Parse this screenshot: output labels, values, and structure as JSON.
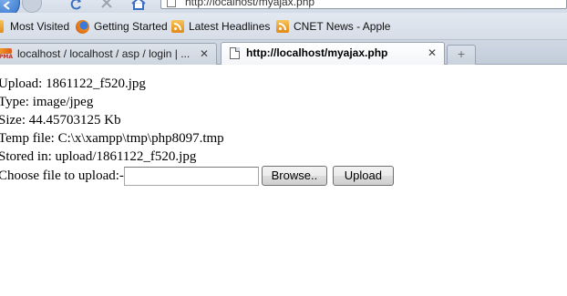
{
  "browser": {
    "url": "http://localhost/myajax.php",
    "bookmarks": [
      {
        "label": "Most Visited",
        "icon": "most-visited-icon"
      },
      {
        "label": "Getting Started",
        "icon": "firefox-icon"
      },
      {
        "label": "Latest Headlines",
        "icon": "rss-icon"
      },
      {
        "label": "CNET News - Apple",
        "icon": "rss-icon"
      }
    ],
    "tabs": [
      {
        "label": "localhost / localhost / asp / login | ...",
        "icon": "phpmyadmin-icon",
        "active": false
      },
      {
        "label": "http://localhost/myajax.php",
        "icon": "page-icon",
        "active": true
      }
    ],
    "tab_close_glyph": "✕",
    "new_tab_glyph": "+"
  },
  "page": {
    "upload": "Upload: 1861122_f520.jpg",
    "type": "Type: image/jpeg",
    "size": "Size: 44.45703125 Kb",
    "temp_file": "Temp file: C:\\x\\xampp\\tmp\\php8097.tmp",
    "stored_in": "Stored in: upload/1861122_f520.jpg",
    "choose_label": "Choose file to upload:-",
    "file_value": "",
    "browse_label": "Browse..",
    "upload_label": "Upload"
  }
}
